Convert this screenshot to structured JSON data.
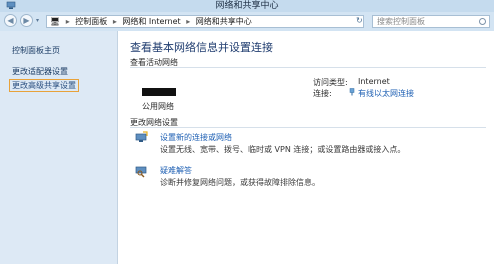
{
  "window": {
    "title": "网络和共享中心"
  },
  "address": {
    "crumbs": [
      "控制面板",
      "网络和 Internet",
      "网络和共享中心"
    ],
    "search_placeholder": "搜索控制面板"
  },
  "sidebar": {
    "items": [
      {
        "label": "控制面板主页"
      },
      {
        "label": "更改适配器设置"
      },
      {
        "label": "更改高级共享设置"
      }
    ]
  },
  "main": {
    "heading": "查看基本网络信息并设置连接",
    "active_section": "查看活动网络",
    "network_type": "公用网络",
    "access_type_label": "访问类型:",
    "access_type_value": "Internet",
    "connections_label": "连接:",
    "connections_value": "有线以太网连接",
    "change_section": "更改网络设置",
    "tasks": [
      {
        "title": "设置新的连接或网络",
        "desc": "设置无线、宽带、拨号、临时或 VPN 连接；或设置路由器或接入点。"
      },
      {
        "title": "疑难解答",
        "desc": "诊断并修复网络问题，或获得故障排除信息。"
      }
    ]
  },
  "colors": {
    "link": "#1d5fb3",
    "heading": "#1e3b6e",
    "sidebar_highlight": "#e8a23a"
  }
}
